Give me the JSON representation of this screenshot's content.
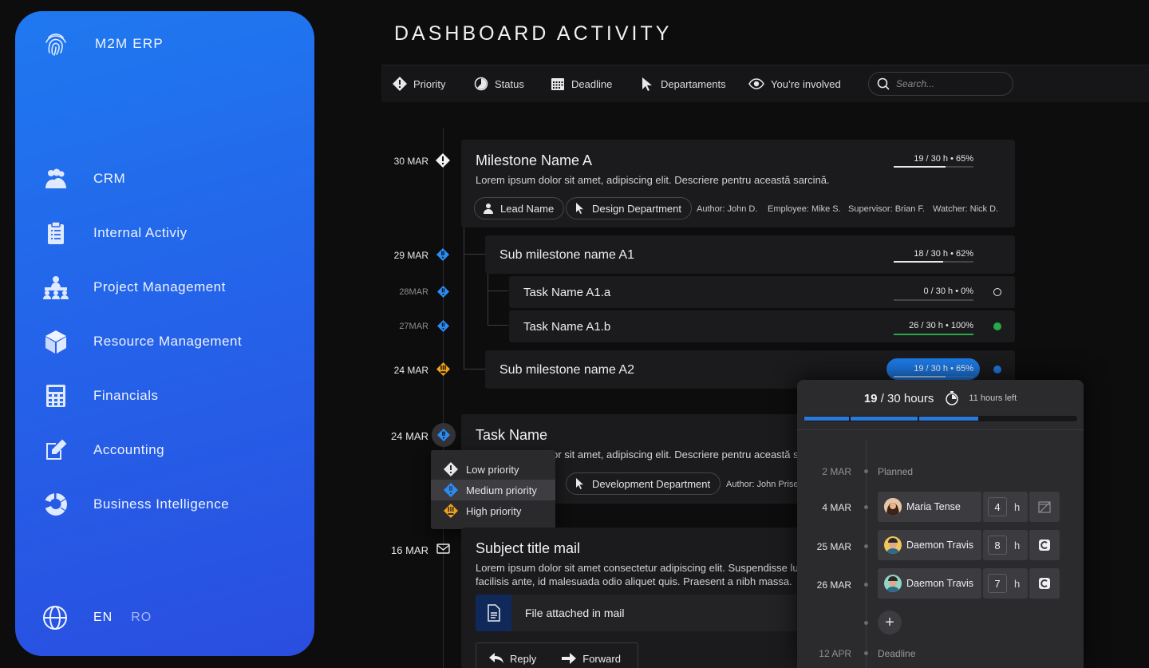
{
  "app": {
    "name": "M2M ERP"
  },
  "sidebar": {
    "items": [
      {
        "label": "CRM",
        "icon": "users-icon"
      },
      {
        "label": "Internal Activiy",
        "icon": "clipboard-icon"
      },
      {
        "label": "Project Management",
        "icon": "presentation-icon"
      },
      {
        "label": "Resource Management",
        "icon": "cube-icon"
      },
      {
        "label": "Financials",
        "icon": "calculator-icon"
      },
      {
        "label": "Accounting",
        "icon": "edit-icon"
      },
      {
        "label": "Business Intelligence",
        "icon": "pie-chart-icon"
      }
    ],
    "languages": [
      "EN",
      "RO"
    ],
    "active_language": "EN"
  },
  "page": {
    "title": "DASHBOARD ACTIVITY"
  },
  "filters": {
    "priority": "Priority",
    "status": "Status",
    "deadline": "Deadline",
    "departments": "Departaments",
    "involved": "You’re involved",
    "search_placeholder": "Search..."
  },
  "colors": {
    "accent": "#1e7be8",
    "medium": "#2a8cf5",
    "high": "#f0a21b",
    "done": "#27a94a"
  },
  "timeline": {
    "milestone": {
      "date": "30 MAR",
      "title": "Milestone Name A",
      "description": "Lorem ipsum dolor sit amet, adipiscing elit. Descriere pentru această sarcină.",
      "progress": "19 / 30 h  •  65%",
      "progress_pct": 65,
      "lead": "Lead Name",
      "department": "Design Department",
      "author": "Author: John D.",
      "employee": "Employee: Mike S.",
      "supervisor": "Supervisor: Brian F.",
      "watcher": "Watcher: Nick D."
    },
    "sub_a1": {
      "date": "29 MAR",
      "title": "Sub milestone name A1",
      "progress": "18 / 30 h  •  62%",
      "progress_pct": 62
    },
    "task_a1a": {
      "date": "28MAR",
      "title": "Task Name A1.a",
      "progress": "0 / 30 h  •  0%",
      "progress_pct": 0
    },
    "task_a1b": {
      "date": "27MAR",
      "title": "Task Name A1.b",
      "progress": "26 / 30 h  •  100%",
      "progress_pct": 100
    },
    "sub_a2": {
      "date": "24 MAR",
      "title": "Sub milestone name A2",
      "progress": "19 / 30 h  •  65%",
      "progress_pct": 65
    },
    "task": {
      "date": "24 MAR",
      "title": "Task Name",
      "description": "Lorem ipsum dolor sit amet, adipiscing elit. Descriere pentru această sarcină.",
      "department": "Development Department",
      "author": "Author: John Priset"
    },
    "mail": {
      "date": "16 MAR",
      "title": "Subject title mail",
      "description_1": "Lorem ipsum dolor sit amet consectetur adipiscing elit. Suspendisse luctus",
      "description_2": "facilisis ante, id malesuada odio aliquet quis. Praesent a nibh massa.",
      "attachment": "File attached in mail",
      "reply": "Reply",
      "forward": "Forward"
    }
  },
  "priority_menu": {
    "items": [
      {
        "label": "Low priority",
        "color": "#e8e8ea"
      },
      {
        "label": "Medium priority",
        "color": "#2a8cf5"
      },
      {
        "label": "High priority",
        "color": "#f0a21b"
      }
    ],
    "selected": "Medium priority"
  },
  "hours_panel": {
    "done": "19",
    "total": " / 30 hours",
    "left": "11 hours left",
    "progress_pct": 65,
    "rows": [
      {
        "date": "2 MAR",
        "label": "Planned"
      },
      {
        "date": "4 MAR",
        "name": "Maria Tense",
        "hours": "4",
        "unit": "h",
        "action_icon": "calendar-disabled-icon"
      },
      {
        "date": "25 MAR",
        "name": "Daemon Travis",
        "hours": "8",
        "unit": "h",
        "action_icon": "cancel-circle-icon"
      },
      {
        "date": "26 MAR",
        "name": "Daemon Travis",
        "hours": "7",
        "unit": "h",
        "action_icon": "cancel-circle-icon"
      },
      {
        "date": "12 APR",
        "label": "Deadline"
      }
    ]
  }
}
